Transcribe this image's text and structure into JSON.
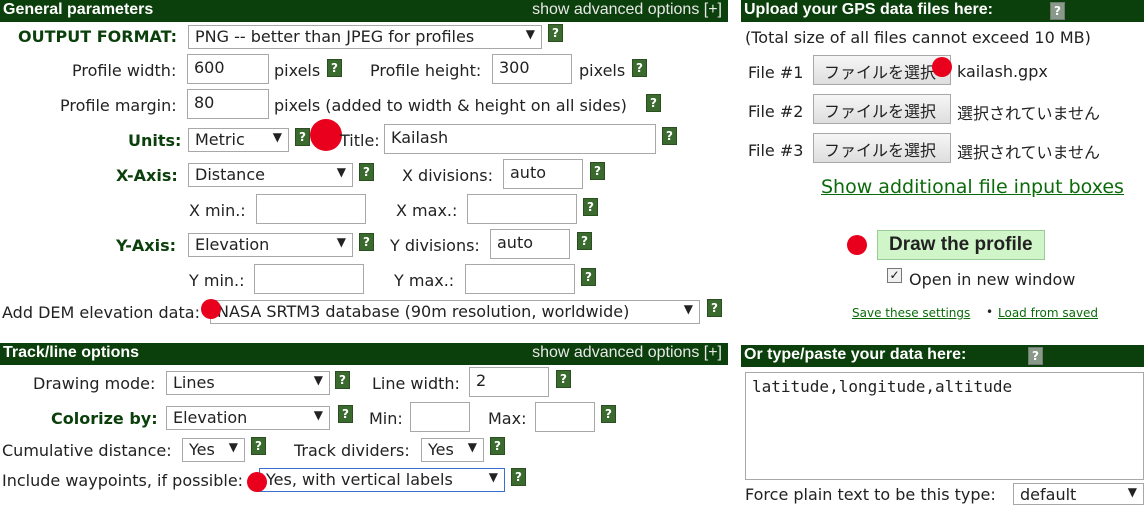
{
  "general": {
    "header_title": "General parameters",
    "advanced_link": "show advanced options [+]",
    "output_format_label": "OUTPUT FORMAT:",
    "output_format_value": "PNG -- better than JPEG for profiles",
    "profile_width_label": "Profile width:",
    "profile_width_value": "600",
    "pixels_label": "pixels",
    "profile_height_label": "Profile height:",
    "profile_height_value": "300",
    "profile_margin_label": "Profile margin:",
    "profile_margin_value": "80",
    "margin_note": "pixels (added to width & height on all sides)",
    "units_label": "Units:",
    "units_value": "Metric",
    "title_label": "Title:",
    "title_value": "Kailash",
    "xaxis_label": "X-Axis:",
    "xaxis_value": "Distance",
    "xdiv_label": "X divisions:",
    "xdiv_value": "auto",
    "xmin_label": "X min.:",
    "xmax_label": "X max.:",
    "yaxis_label": "Y-Axis:",
    "yaxis_value": "Elevation",
    "ydiv_label": "Y divisions:",
    "ydiv_value": "auto",
    "ymin_label": "Y min.:",
    "ymax_label": "Y max.:",
    "dem_label": "Add DEM elevation data:",
    "dem_value": "NASA SRTM3 database (90m resolution, worldwide)"
  },
  "track": {
    "header_title": "Track/line options",
    "advanced_link": "show advanced options [+]",
    "drawing_mode_label": "Drawing mode:",
    "drawing_mode_value": "Lines",
    "line_width_label": "Line width:",
    "line_width_value": "2",
    "colorize_label": "Colorize by:",
    "colorize_value": "Elevation",
    "min_label": "Min:",
    "max_label": "Max:",
    "cumulative_label": "Cumulative distance:",
    "cumulative_value": "Yes",
    "dividers_label": "Track dividers:",
    "dividers_value": "Yes",
    "waypoints_label": "Include waypoints, if possible:",
    "waypoints_value": "Yes, with vertical labels"
  },
  "upload": {
    "header_title": "Upload your GPS data files here:",
    "note": "(Total size of all files cannot exceed 10 MB)",
    "files": [
      {
        "label": "File #1",
        "button": "ファイルを選択",
        "status": "kailash.gpx"
      },
      {
        "label": "File #2",
        "button": "ファイルを選択",
        "status": "選択されていません"
      },
      {
        "label": "File #3",
        "button": "ファイルを選択",
        "status": "選択されていません"
      }
    ],
    "show_more_link": "Show additional file input boxes",
    "draw_button": "Draw the profile",
    "open_new_window_label": "Open in new window",
    "open_new_window_checked": true,
    "save_settings_link": "Save these settings",
    "separator": "•",
    "load_saved_link": "Load from saved"
  },
  "paste": {
    "header_title": "Or type/paste your data here:",
    "textarea_value": "latitude,longitude,altitude",
    "force_label": "Force plain text to be this type:",
    "force_value": "default"
  },
  "icons": {
    "help": "?",
    "dropdown": "▼",
    "check": "✓"
  },
  "colors": {
    "header_bg": "#0b3f0b",
    "marker": "#e8001c",
    "draw_button_bg": "#cff5c8"
  }
}
